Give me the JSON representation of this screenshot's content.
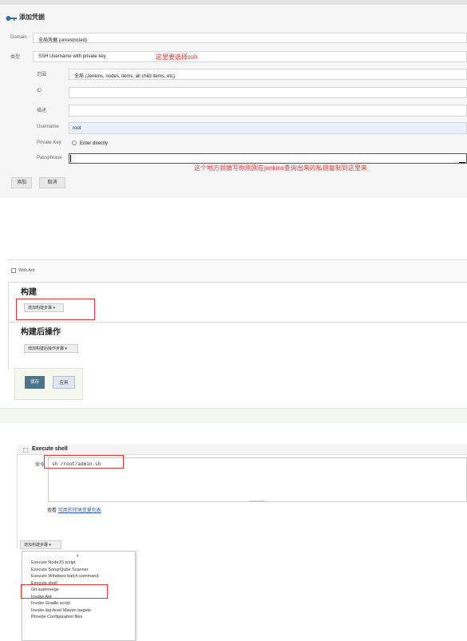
{
  "credentials": {
    "title": "添加凭据",
    "domain_label": "Domain",
    "domain_value": "全局凭据 (unrestricted)",
    "kind_label": "类型",
    "kind_value": "SSH Username with private key",
    "kind_note": "这里要选择ssh",
    "scope_label": "范围",
    "scope_value": "全局 (Jenkins, nodes, items, all child items, etc)",
    "id_label": "ID",
    "id_value": "",
    "description_label": "描述",
    "description_value": "",
    "username_label": "Username",
    "username_value": "root",
    "private_key_label": "Private Key",
    "private_key_option": "Enter directly",
    "passphrase_label": "Passphrase",
    "passphrase_value": "",
    "passphrase_note": "这个地方就填写你刚刚在jenkins查询出来的私钥复制到这里来",
    "add_button": "添加",
    "cancel_button": "取消"
  },
  "build": {
    "with_ant_label": "With Ant",
    "build_header": "构建",
    "add_build_step": "增加构建步骤",
    "post_build_header": "构建后操作",
    "add_post_build_step": "增加构建后操作步骤",
    "save_button": "保存",
    "apply_button": "应用"
  },
  "shell": {
    "title": "Execute shell",
    "command_label": "命令",
    "command_value": "sh /root/admin.sh",
    "env_vars_prefix": "查看",
    "env_vars_link": "可用的环境变量列表",
    "add_build_step": "增加构建步骤",
    "menu_items": [
      "Execute NodeJS script",
      "Execute SonarQube Scanner",
      "Execute Windows batch command",
      "Execute shell",
      "Git automerge",
      "Invoke Ant",
      "Invoke Gradle script",
      "Invoke top-level Maven targets",
      "Provide Configuration files"
    ]
  },
  "colors": {
    "annotation_red": "#e53935",
    "save_button_bg": "#4b758b",
    "link_blue": "#2d5fb8"
  }
}
